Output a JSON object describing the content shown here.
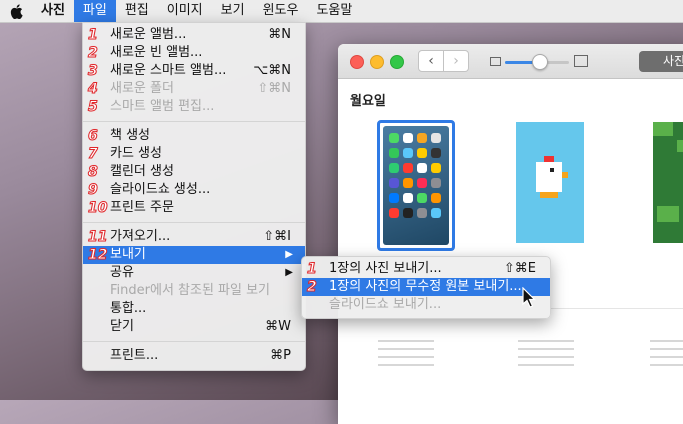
{
  "menubar": {
    "items": [
      {
        "label": "사진",
        "bold": true
      },
      {
        "label": "파일",
        "active": true
      },
      {
        "label": "편집"
      },
      {
        "label": "이미지"
      },
      {
        "label": "보기"
      },
      {
        "label": "윈도우"
      },
      {
        "label": "도움말"
      }
    ]
  },
  "window": {
    "section_title": "월요일",
    "photos_button": "사진"
  },
  "file_menu": {
    "items": [
      {
        "num": "1",
        "label": "새로운 앨범...",
        "shortcut": "⌘N"
      },
      {
        "num": "2",
        "label": "새로운 빈 앨범..."
      },
      {
        "num": "3",
        "label": "새로운 스마트 앨범...",
        "shortcut": "⌥⌘N"
      },
      {
        "num": "4",
        "label": "새로운 폴더",
        "shortcut": "⇧⌘N",
        "disabled": true
      },
      {
        "num": "5",
        "label": "스마트 앨범 편집...",
        "disabled": true
      },
      {
        "num": "6",
        "label": "책 생성"
      },
      {
        "num": "7",
        "label": "카드 생성"
      },
      {
        "num": "8",
        "label": "캘린더 생성"
      },
      {
        "num": "9",
        "label": "슬라이드쇼 생성..."
      },
      {
        "num": "10",
        "label": "프린트 주문"
      },
      {
        "num": "11",
        "label": "가져오기...",
        "shortcut": "⇧⌘I"
      },
      {
        "num": "12",
        "label": "보내기",
        "submenu": true
      },
      {
        "label": "공유",
        "submenu": true
      },
      {
        "label": "Finder에서 참조된 파일 보기",
        "disabled": true
      },
      {
        "label": "통합..."
      },
      {
        "label": "닫기",
        "shortcut": "⌘W"
      },
      {
        "label": "프린트...",
        "shortcut": "⌘P"
      }
    ]
  },
  "export_submenu": {
    "items": [
      {
        "num": "1",
        "label": "1장의 사진 보내기...",
        "shortcut": "⇧⌘E"
      },
      {
        "num": "2",
        "label": "1장의 사진의 무수정 원본 보내기..."
      },
      {
        "label": "슬라이드쇼 보내기...",
        "disabled": true
      }
    ]
  },
  "icons": {
    "apple": "apple-logo-icon",
    "back": "chevron-left-icon",
    "forward": "chevron-right-icon",
    "submenu_arrow": "triangle-right-icon",
    "cursor": "mouse-pointer-icon"
  },
  "colors": {
    "highlight": "#2f7ae5",
    "number_badge": "#e0262a"
  }
}
